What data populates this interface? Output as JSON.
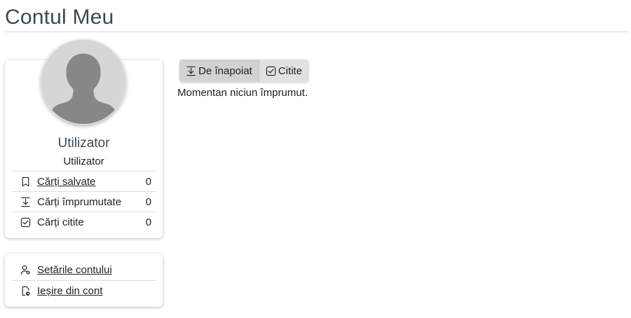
{
  "page": {
    "title": "Contul Meu"
  },
  "profile": {
    "name": "Utilizator",
    "role": "Utilizator",
    "stats": [
      {
        "icon": "bookmark-icon",
        "label": "Cărți salvate",
        "count": "0"
      },
      {
        "icon": "download-icon",
        "label": "Cărți împrumutate",
        "count": "0"
      },
      {
        "icon": "checkbox-icon",
        "label": "Cărți citite",
        "count": "0"
      }
    ]
  },
  "settings": {
    "items": [
      {
        "icon": "user-settings-icon",
        "label": "Setările contului"
      },
      {
        "icon": "logout-icon",
        "label": "Ieșire din cont"
      }
    ]
  },
  "tabs": [
    {
      "icon": "download-icon",
      "label": "De înapoiat",
      "active": true
    },
    {
      "icon": "checkbox-icon",
      "label": "Citite",
      "active": false
    }
  ],
  "content": {
    "empty_message": "Momentan niciun împrumut."
  }
}
